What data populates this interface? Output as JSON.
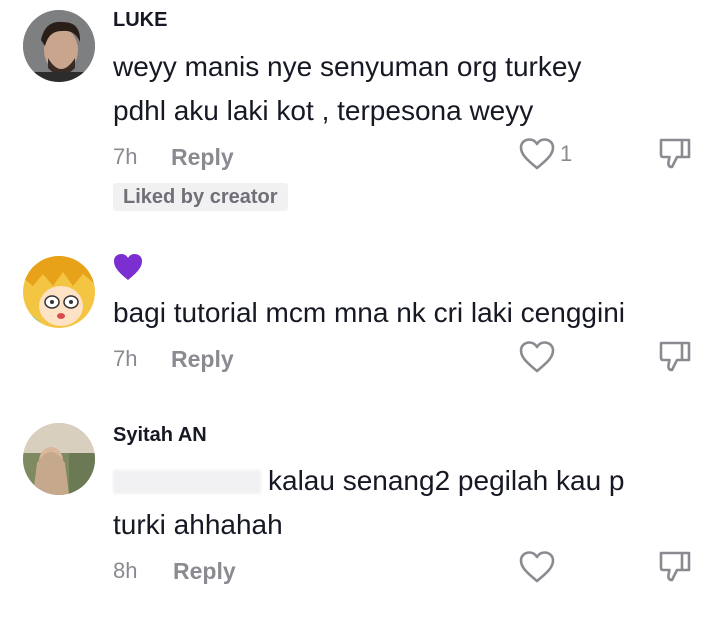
{
  "comments": [
    {
      "username": "LUKE",
      "text_line1": "weyy manis nye senyuman org turkey",
      "text_line2": "pdhl aku laki kot , terpesona weyy",
      "time": "7h",
      "reply_label": "Reply",
      "like_count": "1",
      "badge": "Liked by creator"
    },
    {
      "username_emoji": "💜",
      "text_line1": "bagi tutorial mcm mna nk cri laki cenggini",
      "time": "7h",
      "reply_label": "Reply"
    },
    {
      "username": "Syitah AN",
      "text_line1": "kalau senang2 pegilah kau p",
      "text_line2": "turki ahhahah",
      "time": "8h",
      "reply_label": "Reply"
    }
  ],
  "icons": {
    "heart": "heart-outline-icon",
    "dislike": "thumbs-down-icon"
  },
  "colors": {
    "text": "#161823",
    "muted": "#8a8b91",
    "badge_bg": "#f1f1f2",
    "emoji_purple": "#7b2fd0"
  }
}
